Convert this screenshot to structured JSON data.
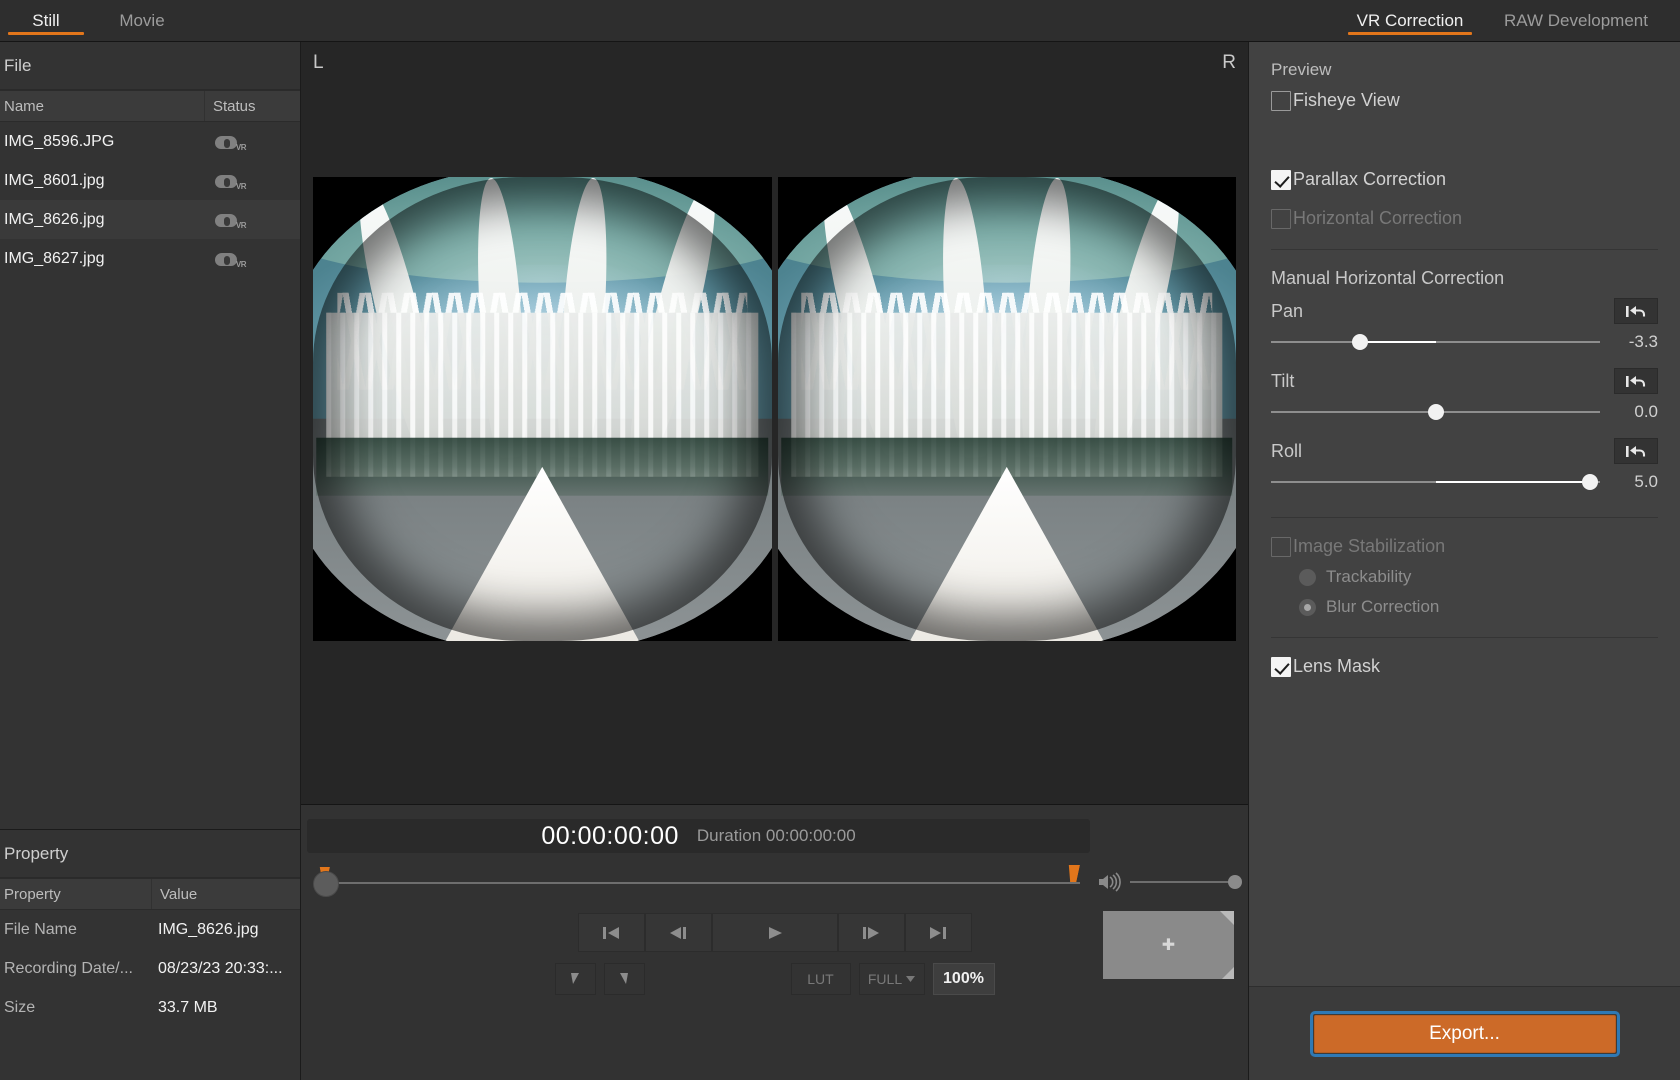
{
  "topbar": {
    "left_tabs": [
      {
        "label": "Still",
        "active": true
      },
      {
        "label": "Movie",
        "active": false
      }
    ],
    "right_tabs": [
      {
        "label": "VR Correction",
        "active": true
      },
      {
        "label": "RAW Development",
        "active": false
      }
    ],
    "accent_color": "#e2761b"
  },
  "left_panel": {
    "title": "File",
    "columns": {
      "name": "Name",
      "status": "Status"
    },
    "files": [
      {
        "name": "IMG_8596.JPG",
        "status_icon": "vr-goggles-icon",
        "selected": false
      },
      {
        "name": "IMG_8601.jpg",
        "status_icon": "vr-goggles-icon",
        "selected": false
      },
      {
        "name": "IMG_8626.jpg",
        "status_icon": "vr-goggles-icon",
        "selected": true
      },
      {
        "name": "IMG_8627.jpg",
        "status_icon": "vr-goggles-icon",
        "selected": false
      }
    ],
    "property_panel": {
      "title": "Property",
      "columns": {
        "property": "Property",
        "value": "Value"
      },
      "rows": [
        {
          "key": "File Name",
          "value": "IMG_8626.jpg"
        },
        {
          "key": "Recording Date/...",
          "value": "08/23/23 20:33:..."
        },
        {
          "key": "Size",
          "value": "33.7 MB"
        }
      ]
    }
  },
  "viewer": {
    "left_eye_label": "L",
    "right_eye_label": "R"
  },
  "transport": {
    "timecode": "00:00:00:00",
    "duration_label": "Duration 00:00:00:00",
    "buttons": [
      {
        "name": "go-to-start-button",
        "icon": "skip-to-start-icon"
      },
      {
        "name": "step-backward-button",
        "icon": "step-back-icon"
      },
      {
        "name": "play-button",
        "icon": "play-icon"
      },
      {
        "name": "step-forward-button",
        "icon": "step-forward-icon"
      },
      {
        "name": "go-to-end-button",
        "icon": "skip-to-end-icon"
      }
    ],
    "mark_in_icon": "mark-in-icon",
    "mark_out_icon": "mark-out-icon",
    "lut_label": "LUT",
    "quality_label": "FULL",
    "zoom_label": "100%",
    "volume_icon": "speaker-icon",
    "navigator_icon": "move-crosshair-icon"
  },
  "right_panel": {
    "preview_label": "Preview",
    "fisheye_view": {
      "label": "Fisheye View",
      "checked": false,
      "disabled": false
    },
    "parallax_correction": {
      "label": "Parallax Correction",
      "checked": true,
      "disabled": false
    },
    "horizontal_correction": {
      "label": "Horizontal Correction",
      "checked": false,
      "disabled": true
    },
    "manual_section_title": "Manual Horizontal Correction",
    "sliders": [
      {
        "name": "Pan",
        "value": "-3.3",
        "percent": 27,
        "fill_from": 27,
        "fill_to": 50,
        "reset_icon": "reset-arrow-icon"
      },
      {
        "name": "Tilt",
        "value": "0.0",
        "percent": 50,
        "fill_from": 50,
        "fill_to": 50,
        "reset_icon": "reset-arrow-icon"
      },
      {
        "name": "Roll",
        "value": "5.0",
        "percent": 98,
        "fill_from": 50,
        "fill_to": 98,
        "reset_icon": "reset-arrow-icon"
      }
    ],
    "image_stabilization": {
      "label": "Image Stabilization",
      "checked": false,
      "disabled": true
    },
    "stabilization_modes": [
      {
        "label": "Trackability",
        "selected": false,
        "disabled": true
      },
      {
        "label": "Blur Correction",
        "selected": true,
        "disabled": true
      }
    ],
    "lens_mask": {
      "label": "Lens Mask",
      "checked": true,
      "disabled": false
    },
    "export_button": {
      "label": "Export...",
      "color": "#cc6a28",
      "focus_ring": "#2f79b5"
    }
  }
}
